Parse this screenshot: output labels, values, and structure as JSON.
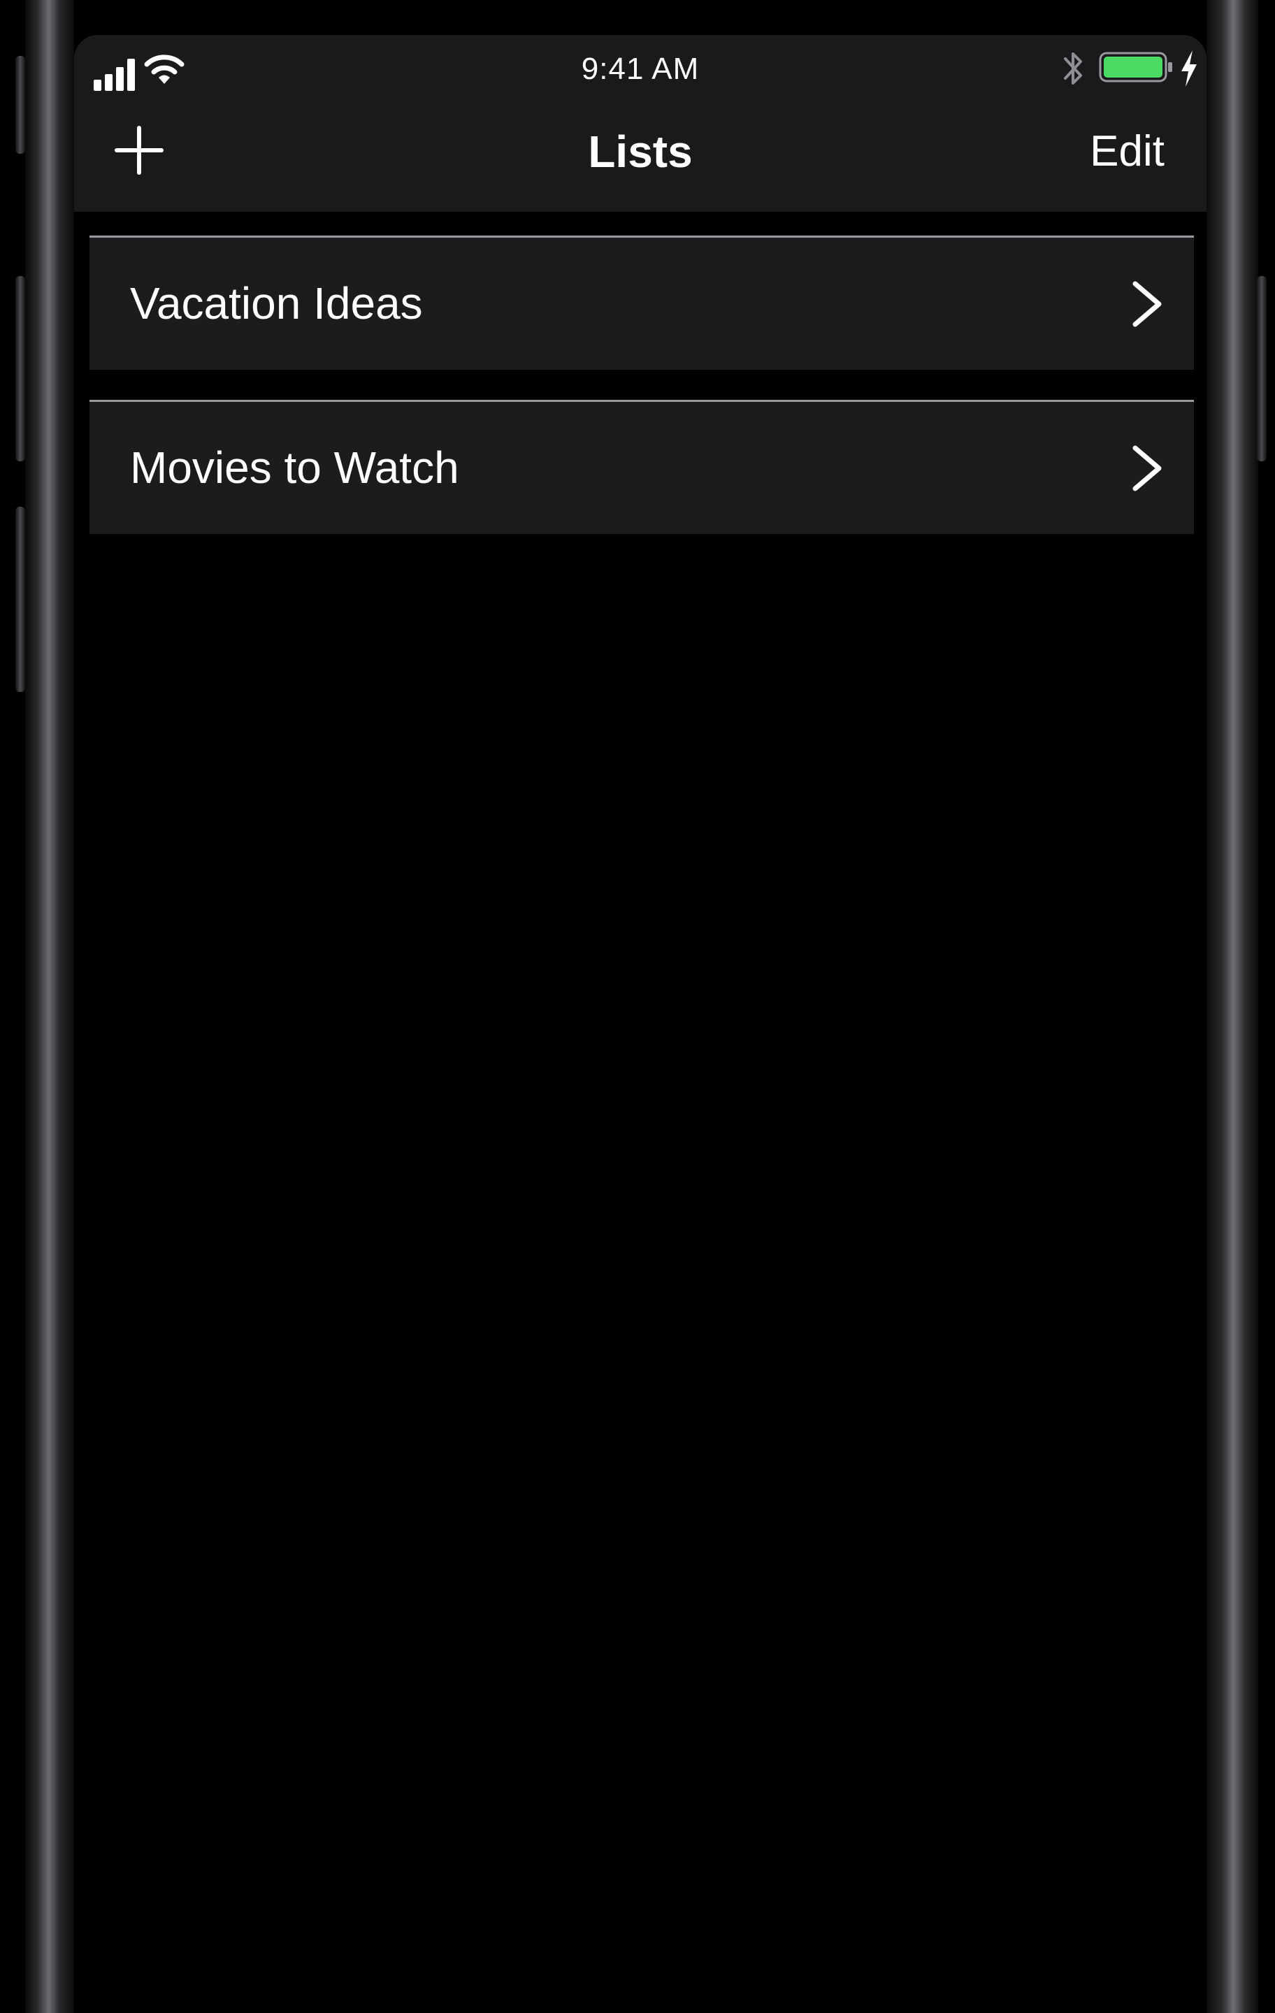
{
  "status_bar": {
    "time": "9:41 AM",
    "signal_icon": "cellular-signal-icon",
    "wifi_icon": "wifi-icon",
    "bluetooth_icon": "bluetooth-icon",
    "battery_icon": "battery-icon",
    "charging_icon": "charging-bolt-icon",
    "battery_level": 1.0,
    "battery_color": "#4cd964"
  },
  "navbar": {
    "title": "Lists",
    "add_icon": "plus-icon",
    "edit_label": "Edit"
  },
  "lists": [
    {
      "label": "Vacation Ideas",
      "icon": "chevron-right-icon"
    },
    {
      "label": "Movies to Watch",
      "icon": "chevron-right-icon"
    }
  ],
  "colors": {
    "background": "#000000",
    "bar_background": "#1a191c",
    "cell_background": "#1c1b1e",
    "text": "#ffffff",
    "separator": "#9a9a9e"
  }
}
